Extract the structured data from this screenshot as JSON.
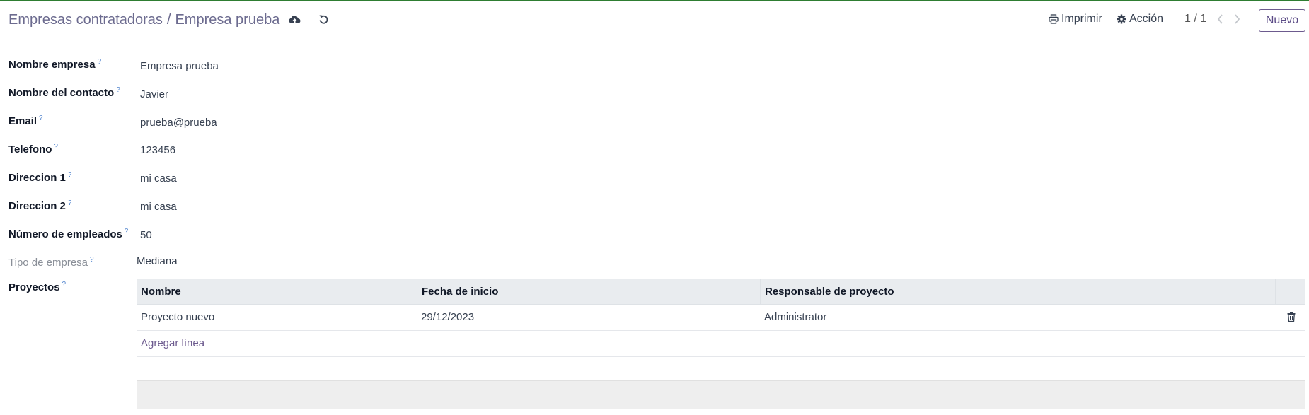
{
  "breadcrumb": {
    "parent": "Empresas contratadoras",
    "separator": "/",
    "current": "Empresa prueba"
  },
  "toolbar": {
    "print_label": "Imprimir",
    "action_label": "Acción",
    "pager": "1 / 1",
    "new_label": "Nuevo"
  },
  "fields": [
    {
      "label": "Nombre empresa",
      "help": "?",
      "value": "Empresa prueba"
    },
    {
      "label": "Nombre del contacto",
      "help": "?",
      "value": "Javier"
    },
    {
      "label": "Email",
      "help": "?",
      "value": "prueba@prueba"
    },
    {
      "label": "Telefono",
      "help": "?",
      "value": "123456"
    },
    {
      "label": "Direccion 1",
      "help": "?",
      "value": "mi casa"
    },
    {
      "label": "Direccion 2",
      "help": "?",
      "value": "mi casa"
    },
    {
      "label": "Número de empleados",
      "help": "?",
      "value": "50"
    },
    {
      "label": "Tipo de empresa",
      "help": "?",
      "value": "Mediana"
    }
  ],
  "projects": {
    "label": "Proyectos",
    "help": "?",
    "columns": [
      "Nombre",
      "Fecha de inicio",
      "Responsable de proyecto"
    ],
    "rows": [
      [
        "Proyecto nuevo",
        "29/12/2023",
        "Administrator"
      ]
    ],
    "add_line": "Agregar línea"
  },
  "icons": {
    "save": "cloud-upload-icon",
    "discard": "undo-icon",
    "print": "printer-icon",
    "action": "gear-icon",
    "prev": "chevron-left-icon",
    "next": "chevron-right-icon",
    "delete": "trash-icon"
  },
  "colors": {
    "accent": "#6c5a8e",
    "top_bar": "#2e7d32",
    "table_header": "#e9ecef"
  }
}
